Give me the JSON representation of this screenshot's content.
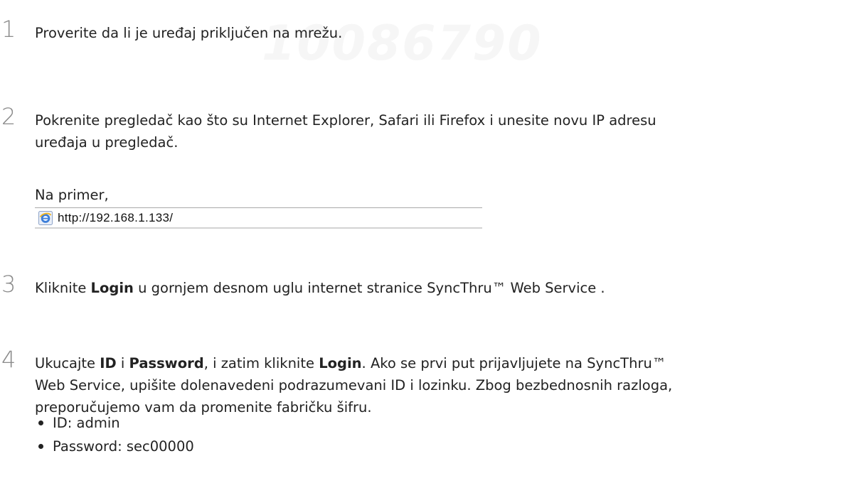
{
  "watermark": "10086790",
  "steps": [
    {
      "number": "1",
      "text": "Proverite da li je uređaj priključen na mrežu."
    },
    {
      "number": "2",
      "line1": "Pokrenite pregledač kao što su Internet Explorer, Safari ili Firefox i unesite novu IP adresu",
      "line2": "uređaja u pregledač.",
      "example_label": "Na primer,",
      "address_bar": {
        "icon": "ie-browser-icon",
        "url": "http://192.168.1.133/"
      }
    },
    {
      "number": "3",
      "before": "Kliknite ",
      "bold": "Login",
      "after": " u gornjem desnom uglu internet stranice SyncThru™ Web Service ."
    },
    {
      "number": "4",
      "t1": "Ukucajte ",
      "b1": "ID",
      "t2": " i ",
      "b2": "Password",
      "t3": ", i zatim kliknite ",
      "b3": "Login",
      "t4": ". Ako se prvi put prijavljujete na SyncThru™",
      "line2": "Web Service, upišite dolenavedeni podrazumevani ID i lozinku. Zbog bezbednosnih razloga,",
      "line3": "preporučujemo vam da promenite fabričku šifru.",
      "bullets": [
        "ID: admin",
        "Password: sec00000"
      ]
    }
  ]
}
